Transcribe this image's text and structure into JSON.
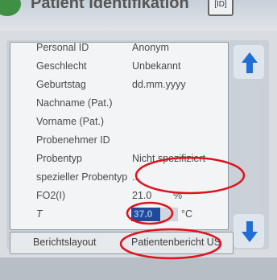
{
  "header": {
    "title": "Patient Identifikation",
    "button_label": "[ID]"
  },
  "fields": [
    {
      "label": "Personal ID",
      "value": "Anonym"
    },
    {
      "label": "Geschlecht",
      "value": "Unbekannt"
    },
    {
      "label": "Geburtstag",
      "value": "dd.mm.yyyy"
    },
    {
      "label": "Nachname (Pat.)",
      "value": ""
    },
    {
      "label": "Vorname (Pat.)",
      "value": ""
    },
    {
      "label": "Probenehmer ID",
      "value": ""
    },
    {
      "label": "Probentyp",
      "value": "Nicht spezifiziert"
    },
    {
      "label": "spezieller Probentyp",
      "value": "..."
    },
    {
      "label": "FO2(I)",
      "value": "21.0",
      "unit": "%"
    },
    {
      "label": "T",
      "value": "37.0",
      "unit": "°C"
    }
  ],
  "footer": {
    "label": "Berichtslayout",
    "value": "Patientenbericht US"
  },
  "icons": {
    "scroll_up": "arrow-up-icon",
    "scroll_down": "arrow-down-icon"
  },
  "colors": {
    "arrow_blue": "#1f6fd6",
    "annotation_red": "#e0121d",
    "selected_value": "#1f4a9c"
  }
}
